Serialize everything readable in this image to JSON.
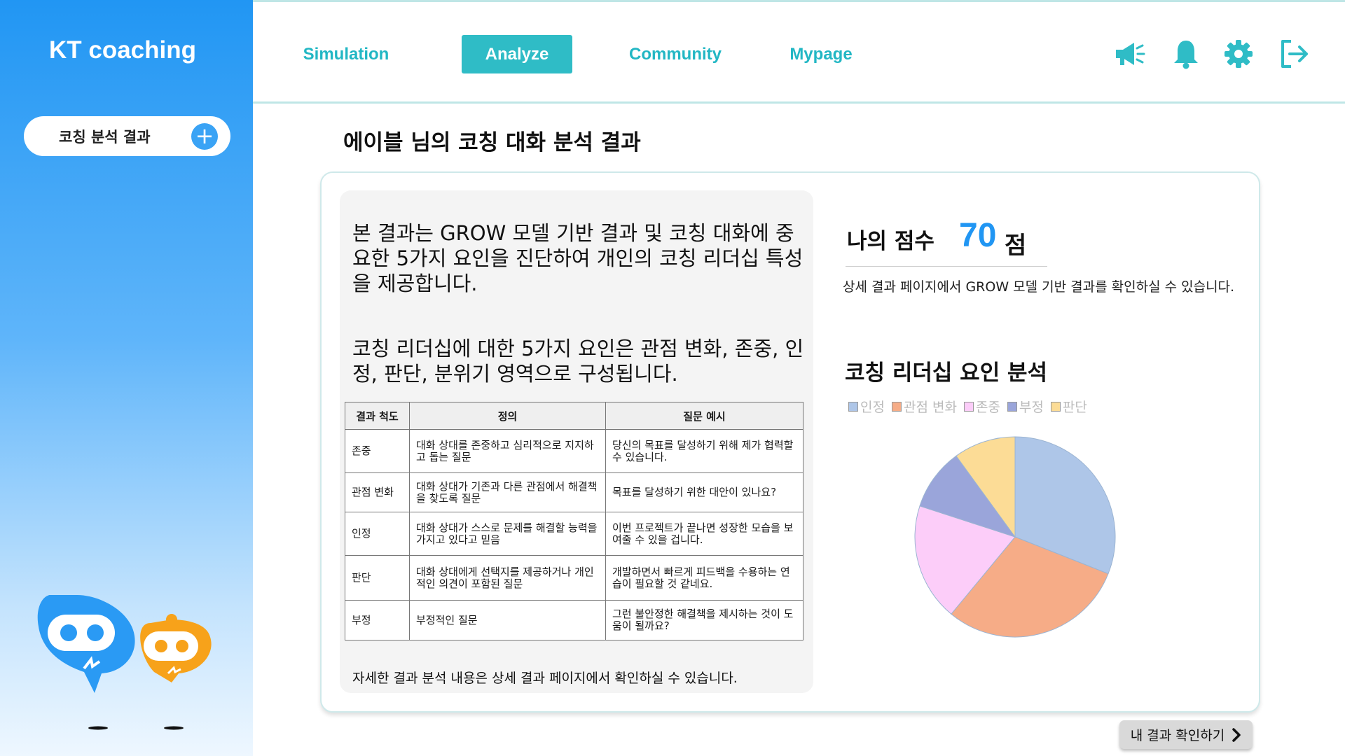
{
  "app": {
    "title": "KT coaching"
  },
  "sidebar": {
    "items": [
      {
        "label": "코칭 분석 결과",
        "action": "+"
      }
    ]
  },
  "nav": {
    "tabs": [
      {
        "label": "Simulation",
        "active": false
      },
      {
        "label": "Analyze",
        "active": true
      },
      {
        "label": "Community",
        "active": false
      },
      {
        "label": "Mypage",
        "active": false
      }
    ]
  },
  "toolbar": {
    "icons": [
      "megaphone-icon",
      "bell-icon",
      "gear-icon",
      "logout-icon"
    ]
  },
  "page": {
    "title": "에이블 님의 코칭 대화 분석 결과"
  },
  "intro": {
    "paragraph1": "본 결과는 GROW 모델 기반 결과 및 코칭 대화에 중요한 5가지 요인을 진단하여 개인의 코칭 리더십 특성을 제공합니다.",
    "paragraph2": "코칭 리더십에 대한 5가지 요인은 관점 변화, 존중, 인정, 판단, 분위기 영역으로 구성됩니다."
  },
  "table": {
    "headers": [
      "결과 척도",
      "정의",
      "질문 예시"
    ],
    "rows": [
      [
        "존중",
        "대화 상대를 존중하고 심리적으로 지지하고 돕는 질문",
        "당신의 목표를 달성하기 위해 제가 협력할 수 있습니다."
      ],
      [
        "관점 변화",
        "대화 상대가 기존과 다른 관점에서 해결책을 찾도록 질문",
        "목표를 달성하기 위한 대안이 있나요?"
      ],
      [
        "인정",
        "대화 상대가 스스로 문제를 해결할 능력을 가지고 있다고 믿음",
        "이번 프로젝트가 끝나면 성장한 모습을 보여줄 수 있을 겁니다."
      ],
      [
        "판단",
        "대화 상대에게 선택지를 제공하거나 개인적인 의견이 포함된 질문",
        "개발하면서 빠르게 피드백을 수용하는 연습이 필요할 것 같네요."
      ],
      [
        "부정",
        "부정적인 질문",
        "그런 불안정한 해결책을 제시하는 것이 도움이 될까요?"
      ]
    ]
  },
  "footnote": "자세한 결과 분석 내용은 상세 결과 페이지에서 확인하실 수 있습니다.",
  "score": {
    "label": "나의 점수",
    "value": "70",
    "unit": "점",
    "note": "상세 결과 페이지에서 GROW 모델 기반 결과를 확인하실 수 있습니다."
  },
  "chart_data": {
    "type": "pie",
    "title": "코칭 리더십 요인 분석",
    "legend_position": "top-left",
    "categories": [
      "인정",
      "관점 변화",
      "존중",
      "부정",
      "판단"
    ],
    "values": [
      31,
      30,
      19,
      10,
      10
    ],
    "colors": [
      "#aec6e8",
      "#f6ac87",
      "#fccdf9",
      "#9aa5da",
      "#fcdc96"
    ]
  },
  "cta": {
    "label": "내 결과 확인하기"
  }
}
